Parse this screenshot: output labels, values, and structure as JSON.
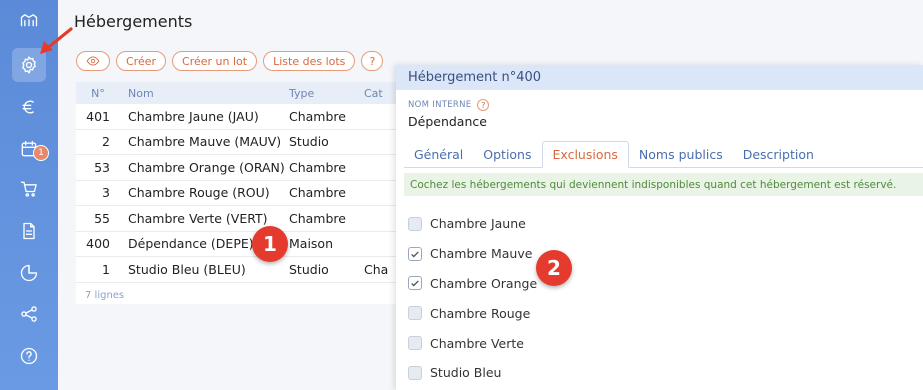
{
  "page": {
    "title": "Hébergements"
  },
  "sidebar": {
    "icons": [
      "home-icon",
      "gear-icon",
      "euro-icon",
      "calendar-icon",
      "cart-icon",
      "document-icon",
      "pie-chart-icon",
      "share-icon",
      "help-icon"
    ],
    "calendar_badge": "1"
  },
  "toolbar": {
    "create_label": "Créer",
    "create_lot_label": "Créer un lot",
    "lot_list_label": "Liste des lots",
    "help_label": "?"
  },
  "table": {
    "columns": [
      "N°",
      "Nom",
      "Type",
      "Cat"
    ],
    "rows": [
      {
        "num": "401",
        "nom": "Chambre Jaune (JAU)",
        "type": "Chambre",
        "cat": ""
      },
      {
        "num": "2",
        "nom": "Chambre Mauve (MAUV)",
        "type": "Studio",
        "cat": ""
      },
      {
        "num": "53",
        "nom": "Chambre Orange (ORAN)",
        "type": "Chambre",
        "cat": ""
      },
      {
        "num": "3",
        "nom": "Chambre Rouge (ROU)",
        "type": "Chambre",
        "cat": ""
      },
      {
        "num": "55",
        "nom": "Chambre Verte (VERT)",
        "type": "Chambre",
        "cat": ""
      },
      {
        "num": "400",
        "nom": "Dépendance (DEPE)",
        "type": "Maison",
        "cat": ""
      },
      {
        "num": "1",
        "nom": "Studio Bleu (BLEU)",
        "type": "Studio",
        "cat": "Cha"
      }
    ],
    "count_label": "7 lignes"
  },
  "markers": {
    "first": "1",
    "second": "2"
  },
  "panel": {
    "title": "Hébergement n°400",
    "field_label": "NOM INTERNE",
    "field_help": "?",
    "field_value": "Dépendance",
    "tabs": [
      "Général",
      "Options",
      "Exclusions",
      "Noms publics",
      "Description"
    ],
    "active_tab": "Exclusions",
    "notice": "Cochez les hébergements qui deviennent indisponibles quand cet hébergement est réservé.",
    "exclusions": [
      {
        "label": "Chambre Jaune",
        "checked": false
      },
      {
        "label": "Chambre Mauve",
        "checked": true
      },
      {
        "label": "Chambre Orange",
        "checked": true
      },
      {
        "label": "Chambre Rouge",
        "checked": false
      },
      {
        "label": "Chambre Verte",
        "checked": false
      },
      {
        "label": "Studio Bleu",
        "checked": false
      }
    ]
  },
  "colors": {
    "sidebar": "#5b8bd8",
    "accent": "#d9683f",
    "marker": "#e43b2e",
    "notice_bg": "#e9f4e6"
  }
}
